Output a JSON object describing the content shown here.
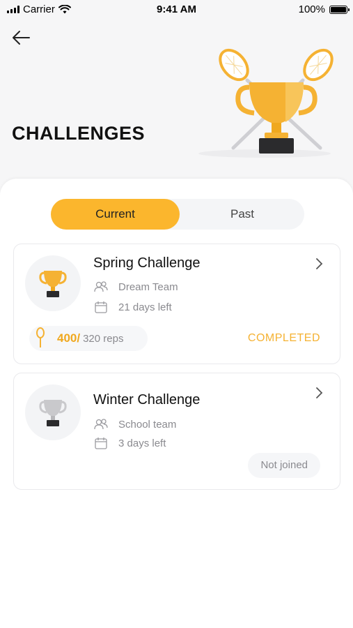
{
  "status_bar": {
    "carrier": "Carrier",
    "time": "9:41 AM",
    "battery": "100%"
  },
  "header": {
    "title": "CHALLENGES"
  },
  "tabs": [
    {
      "label": "Current",
      "active": true
    },
    {
      "label": "Past",
      "active": false
    }
  ],
  "challenges": [
    {
      "title": "Spring Challenge",
      "team": "Dream Team",
      "days_left": "21 days left",
      "reps_done": "400/",
      "reps_total": "320 reps",
      "status": "COMPLETED",
      "trophy_color": "#f5b233"
    },
    {
      "title": "Winter Challenge",
      "team": "School team",
      "days_left": "3 days left",
      "status": "Not joined",
      "trophy_color": "#c9c9cc"
    }
  ],
  "colors": {
    "accent": "#fbb62d",
    "completed": "#f5b233",
    "muted": "#8a8a8f"
  }
}
